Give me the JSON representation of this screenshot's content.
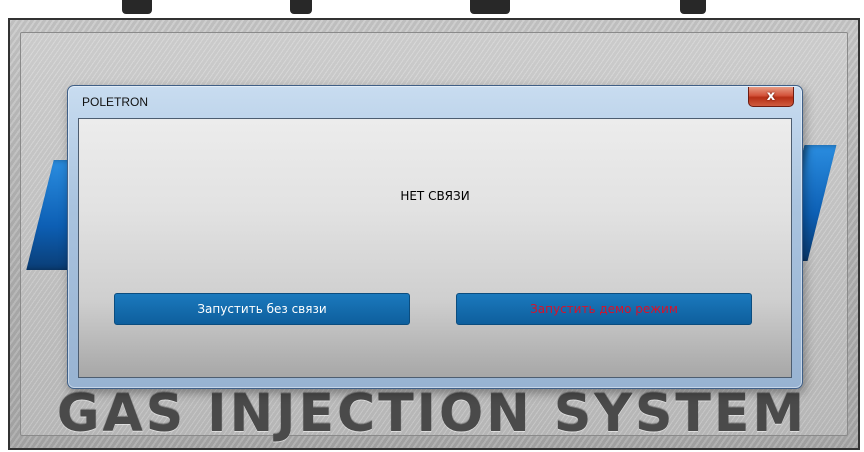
{
  "app": {
    "title": "GAS INJECTION SYSTEM"
  },
  "dialog": {
    "title": "POLETRON",
    "close_label": "x",
    "message": "НЕТ СВЯЗИ",
    "buttons": {
      "start_offline": "Запустить без связи",
      "start_demo": "Запустить демо режим"
    }
  },
  "colors": {
    "button_bg": "#0e5f9d",
    "button_text": "#ffffff",
    "demo_text": "#d8122a",
    "close_button": "#c7452a",
    "logo_blue": "#1a7ad0"
  },
  "icons": {
    "close": "close-icon"
  }
}
